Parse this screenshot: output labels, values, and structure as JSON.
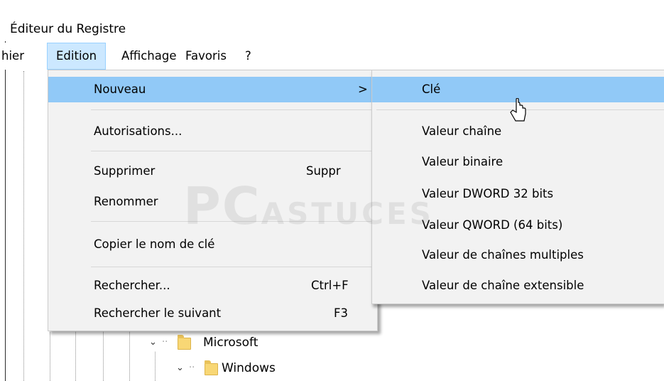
{
  "window": {
    "title": "Éditeur du Registre"
  },
  "menubar": {
    "items": [
      {
        "label": "hier"
      },
      {
        "label": "Edition"
      },
      {
        "label": "Affichage"
      },
      {
        "label": "Favoris"
      },
      {
        "label": "?"
      }
    ]
  },
  "edition_menu": {
    "items": [
      {
        "label": "Nouveau",
        "shortcut": ">"
      },
      {
        "label": "Autorisations...",
        "shortcut": ""
      },
      {
        "label": "Supprimer",
        "shortcut": "Suppr"
      },
      {
        "label": "Renommer",
        "shortcut": ""
      },
      {
        "label": "Copier le nom de clé",
        "shortcut": ""
      },
      {
        "label": "Rechercher...",
        "shortcut": "Ctrl+F"
      },
      {
        "label": "Rechercher le suivant",
        "shortcut": "F3"
      }
    ]
  },
  "nouveau_submenu": {
    "items": [
      {
        "label": "Clé"
      },
      {
        "label": "Valeur chaîne"
      },
      {
        "label": "Valeur binaire"
      },
      {
        "label": "Valeur DWORD 32 bits"
      },
      {
        "label": "Valeur QWORD (64 bits)"
      },
      {
        "label": "Valeur de chaînes multiples"
      },
      {
        "label": "Valeur de chaîne extensible"
      }
    ]
  },
  "tree": {
    "nodes": [
      {
        "label": "Microsoft",
        "icon": "folder-icon"
      },
      {
        "label": "Windows",
        "icon": "folder-icon"
      }
    ]
  },
  "watermark": {
    "main": "PC",
    "sub": "ASTUCES"
  },
  "colors": {
    "highlight": "#91c9f7",
    "menu_bg": "#f2f2f2",
    "active_menubar": "#cce8ff"
  }
}
